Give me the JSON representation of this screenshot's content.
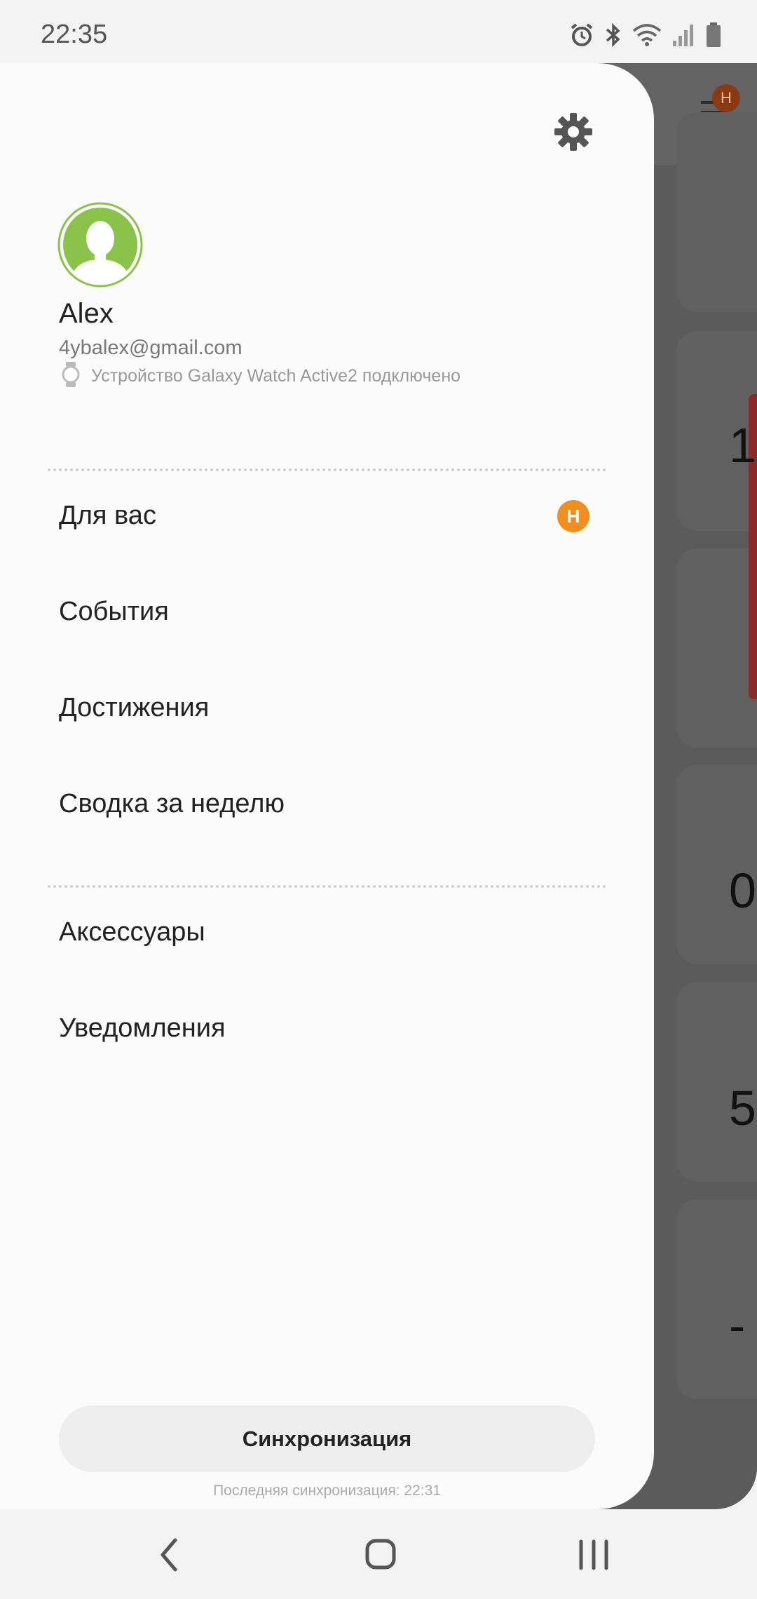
{
  "status_bar": {
    "time": "22:35",
    "icons": [
      "alarm-icon",
      "bluetooth-icon",
      "wifi-icon",
      "signal-icon",
      "battery-icon"
    ]
  },
  "background_app": {
    "badge": "Н",
    "card_values": [
      "1",
      "0",
      "5",
      "-"
    ]
  },
  "drawer": {
    "settings_icon": "gear-icon",
    "profile": {
      "name": "Alex",
      "email": "4ybalex@gmail.com",
      "device_status": "Устройство Galaxy Watch Active2 подключено"
    },
    "menu_section_1": [
      {
        "label": "Для вас",
        "badge": "Н"
      },
      {
        "label": "События"
      },
      {
        "label": "Достижения"
      },
      {
        "label": "Сводка за неделю"
      }
    ],
    "menu_section_2": [
      {
        "label": "Аксессуары"
      },
      {
        "label": "Уведомления"
      }
    ],
    "sync_button": "Синхронизация",
    "last_sync": "Последняя синхронизация: 22:31"
  },
  "colors": {
    "badge": "#f18f1e",
    "avatar_green": "#8bc34a",
    "drawer_bg": "#fbfbfb"
  },
  "nav_bar": {
    "icons": [
      "back-icon",
      "home-icon",
      "recents-icon"
    ]
  }
}
